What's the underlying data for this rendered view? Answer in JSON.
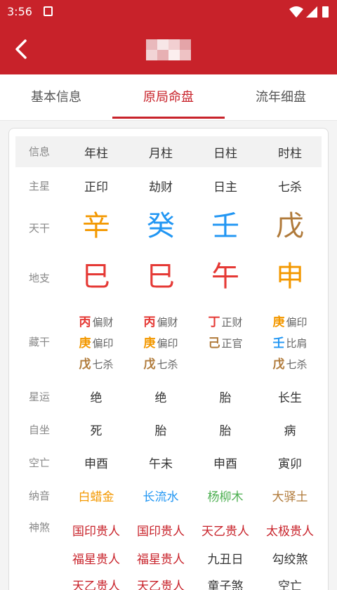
{
  "status": {
    "time": "3:56"
  },
  "tabs": [
    {
      "label": "基本信息"
    },
    {
      "label": "原局命盘"
    },
    {
      "label": "流年细盘"
    }
  ],
  "header": {
    "label": "信息",
    "cols": [
      "年柱",
      "月柱",
      "日柱",
      "时柱"
    ]
  },
  "rows": {
    "zhuxing": {
      "label": "主星",
      "values": [
        "正印",
        "劫财",
        "日主",
        "七杀"
      ]
    },
    "tiangan": {
      "label": "天干",
      "values": [
        "辛",
        "癸",
        "壬",
        "戊"
      ]
    },
    "dizhi": {
      "label": "地支",
      "values": [
        "巳",
        "巳",
        "午",
        "申"
      ]
    },
    "canggan": {
      "label": "藏干",
      "cols": [
        [
          {
            "char": "丙",
            "god": "偏财"
          },
          {
            "char": "庚",
            "god": "偏印"
          },
          {
            "char": "戊",
            "god": "七杀"
          }
        ],
        [
          {
            "char": "丙",
            "god": "偏财"
          },
          {
            "char": "庚",
            "god": "偏印"
          },
          {
            "char": "戊",
            "god": "七杀"
          }
        ],
        [
          {
            "char": "丁",
            "god": "正财"
          },
          {
            "char": "己",
            "god": "正官"
          }
        ],
        [
          {
            "char": "庚",
            "god": "偏印"
          },
          {
            "char": "壬",
            "god": "比肩"
          },
          {
            "char": "戊",
            "god": "七杀"
          }
        ]
      ]
    },
    "xingyun": {
      "label": "星运",
      "values": [
        "绝",
        "绝",
        "胎",
        "长生"
      ]
    },
    "zizuo": {
      "label": "自坐",
      "values": [
        "死",
        "胎",
        "胎",
        "病"
      ]
    },
    "kongwang": {
      "label": "空亡",
      "values": [
        "申酉",
        "午未",
        "申酉",
        "寅卯"
      ]
    },
    "nayin": {
      "label": "纳音",
      "values": [
        "白蜡金",
        "长流水",
        "杨柳木",
        "大驿土"
      ]
    },
    "shensha": {
      "label": "神煞",
      "rows": [
        [
          "国印贵人",
          "国印贵人",
          "天乙贵人",
          "太极贵人"
        ],
        [
          "福星贵人",
          "福星贵人",
          "九丑日",
          "勾绞煞"
        ],
        [
          "天乙贵人",
          "天乙贵人",
          "童子煞",
          "空亡"
        ]
      ]
    }
  },
  "colors": {
    "brand": "#c8222a",
    "metal": "#f39800",
    "water": "#2196f3",
    "fire": "#e53935",
    "earth": "#b07a3a",
    "wood": "#4caf50"
  }
}
